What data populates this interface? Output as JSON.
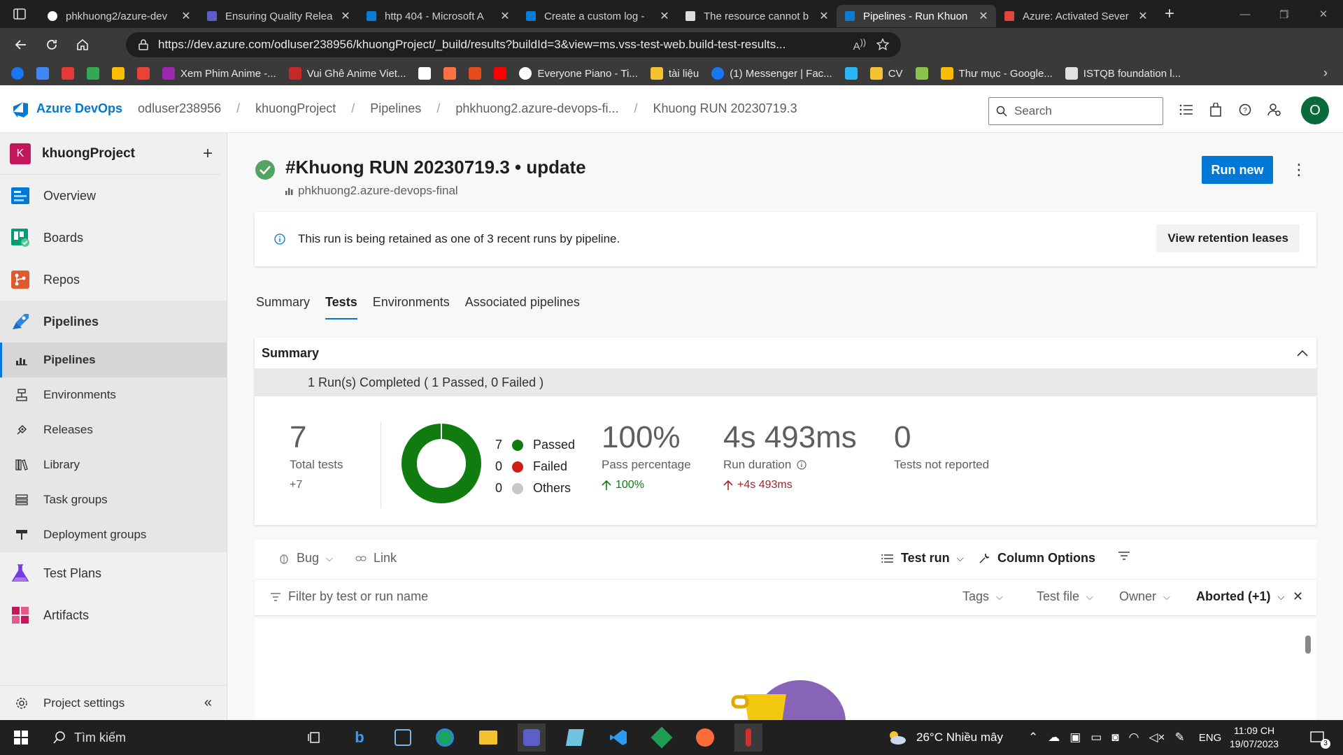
{
  "browser": {
    "tabs": [
      {
        "title": "phkhuong2/azure-dev",
        "icon": "github-icon"
      },
      {
        "title": "Ensuring Quality Relea",
        "icon": "shield-icon"
      },
      {
        "title": "http 404 - Microsoft A",
        "icon": "azure-icon"
      },
      {
        "title": "Create a custom log -",
        "icon": "azure-icon"
      },
      {
        "title": "The resource cannot b",
        "icon": "document-icon"
      },
      {
        "title": "Pipelines - Run Khuon",
        "icon": "azure-devops-icon",
        "active": true
      },
      {
        "title": "Azure: Activated Sever",
        "icon": "gmail-icon"
      }
    ],
    "url": "https://dev.azure.com/odluser238956/khuongProject/_build/results?buildId=3&view=ms.vss-test-web.build-test-results...",
    "bookmarks": [
      {
        "label": "",
        "icon": "facebook-icon"
      },
      {
        "label": "",
        "icon": "translate-icon"
      },
      {
        "label": "",
        "icon": "app-icon"
      },
      {
        "label": "",
        "icon": "maps-icon"
      },
      {
        "label": "",
        "icon": "drive-icon"
      },
      {
        "label": "",
        "icon": "gmail-icon"
      },
      {
        "label": "Xem Phim Anime -...",
        "icon": "play-icon"
      },
      {
        "label": "Vui Ghê Anime Viet...",
        "icon": "anime-icon"
      },
      {
        "label": "",
        "icon": "gk-icon"
      },
      {
        "label": "",
        "icon": "gear-icon"
      },
      {
        "label": "",
        "icon": "shop-icon"
      },
      {
        "label": "",
        "icon": "youtube-icon"
      },
      {
        "label": "Everyone Piano - Ti...",
        "icon": "google-icon"
      },
      {
        "label": "tài liệu",
        "icon": "folder-icon"
      },
      {
        "label": "(1) Messenger | Fac...",
        "icon": "facebook-icon"
      },
      {
        "label": "",
        "icon": "camera-icon"
      },
      {
        "label": "CV",
        "icon": "folder-icon"
      },
      {
        "label": "",
        "icon": "android-icon"
      },
      {
        "label": "Thư mục - Google...",
        "icon": "drive-icon"
      },
      {
        "label": "ISTQB foundation l...",
        "icon": "document-icon"
      }
    ]
  },
  "header": {
    "brand": "Azure DevOps",
    "breadcrumbs": [
      "odluser238956",
      "khuongProject",
      "Pipelines",
      "phkhuong2.azure-devops-fi...",
      "Khuong RUN 20230719.3"
    ],
    "search_placeholder": "Search",
    "avatar_letter": "O"
  },
  "sidebar": {
    "project_initial": "K",
    "project_name": "khuongProject",
    "items": [
      {
        "label": "Overview",
        "icon": "overview-icon"
      },
      {
        "label": "Boards",
        "icon": "boards-icon"
      },
      {
        "label": "Repos",
        "icon": "repos-icon"
      },
      {
        "label": "Pipelines",
        "icon": "pipelines-icon"
      }
    ],
    "pipeline_sub": [
      {
        "label": "Pipelines",
        "icon": "pipeline-sub-icon"
      },
      {
        "label": "Environments",
        "icon": "environments-icon"
      },
      {
        "label": "Releases",
        "icon": "releases-icon"
      },
      {
        "label": "Library",
        "icon": "library-icon"
      },
      {
        "label": "Task groups",
        "icon": "task-groups-icon"
      },
      {
        "label": "Deployment groups",
        "icon": "deployment-groups-icon"
      }
    ],
    "bottom_items": [
      {
        "label": "Test Plans",
        "icon": "test-plans-icon"
      },
      {
        "label": "Artifacts",
        "icon": "artifacts-icon"
      }
    ],
    "settings": "Project settings"
  },
  "run": {
    "title": "#Khuong RUN 20230719.3 • update",
    "pipeline": "phkhuong2.azure-devops-final",
    "run_new": "Run new",
    "retention_msg": "This run is being retained as one of 3 recent runs by pipeline.",
    "retention_btn": "View retention leases"
  },
  "tabs": [
    "Summary",
    "Tests",
    "Environments",
    "Associated pipelines"
  ],
  "summary": {
    "heading": "Summary",
    "runs_line": "1 Run(s) Completed ( 1 Passed, 0 Failed )",
    "total": "7",
    "total_label": "Total tests",
    "total_delta": "+7",
    "legend": [
      {
        "count": "7",
        "label": "Passed",
        "color": "#107c10"
      },
      {
        "count": "0",
        "label": "Failed",
        "color": "#d01c12"
      },
      {
        "count": "0",
        "label": "Others",
        "color": "#c8c8c8"
      }
    ],
    "pass_pct": "100%",
    "pass_label": "Pass percentage",
    "pass_delta": "100%",
    "duration": "4s 493ms",
    "duration_label": "Run duration",
    "duration_delta": "+4s 493ms",
    "not_reported": "0",
    "not_reported_label": "Tests not reported",
    "colors": {
      "pass": "#107c10",
      "fail": "#a4262c"
    }
  },
  "toolbar": {
    "bug": "Bug",
    "link": "Link",
    "test_run": "Test run",
    "column_options": "Column Options"
  },
  "filter": {
    "placeholder": "Filter by test or run name",
    "tags": "Tags",
    "test_file": "Test file",
    "owner": "Owner",
    "outcome": "Aborted (+1)"
  },
  "taskbar": {
    "search": "Tìm kiếm",
    "weather": "26°C  Nhiều mây",
    "lang": "ENG",
    "time": "11:09 CH",
    "date": "19/07/2023",
    "notif": "3"
  }
}
